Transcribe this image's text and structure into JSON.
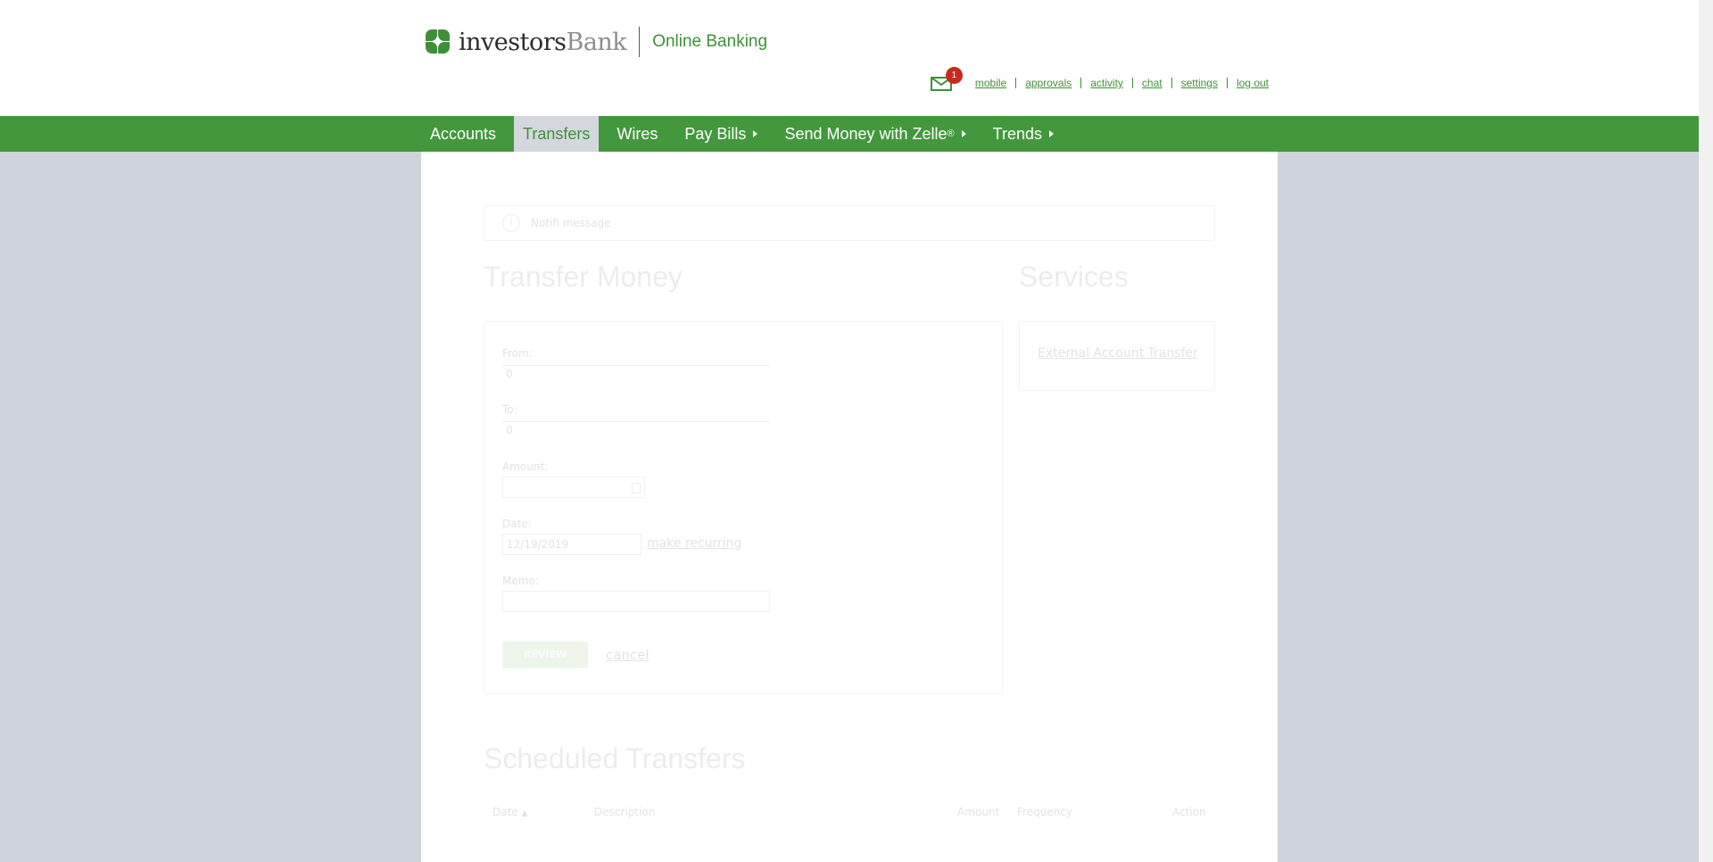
{
  "header": {
    "brand_part1": "investors",
    "brand_part2": "Bank",
    "product": "Online Banking",
    "message_count": "1",
    "utility_links": [
      "mobile",
      "approvals",
      "activity",
      "chat",
      "settings",
      "log out"
    ]
  },
  "nav": {
    "items": [
      {
        "label": "Accounts",
        "active": false,
        "has_caret": false
      },
      {
        "label": "Transfers",
        "active": true,
        "has_caret": false
      },
      {
        "label": "Wires",
        "active": false,
        "has_caret": false
      },
      {
        "label": "Pay Bills",
        "active": false,
        "has_caret": true
      },
      {
        "label": "Send Money with Zelle",
        "sup": "®",
        "active": false,
        "has_caret": true
      },
      {
        "label": "Trends",
        "active": false,
        "has_caret": true
      }
    ]
  },
  "notification": {
    "icon": "i",
    "text": "Notifi message"
  },
  "transfer": {
    "title": "Transfer Money",
    "from_label": "From:",
    "from_value": "0",
    "to_label": "To:",
    "to_value": "0",
    "amount_label": "Amount:",
    "amount_value": "",
    "date_label": "Date:",
    "date_value": "12/19/2019",
    "make_recurring": "make recurring",
    "memo_label": "Memo:",
    "memo_value": "",
    "review_button": "REVIEW",
    "cancel_link": "cancel"
  },
  "services": {
    "title": "Services",
    "links": [
      "External Account Transfer"
    ]
  },
  "scheduled": {
    "title": "Scheduled Transfers",
    "columns": [
      "Date",
      "Description",
      "Amount",
      "Frequency",
      "Action"
    ]
  },
  "colors": {
    "brand_green": "#43983d",
    "badge_red": "#c8291f",
    "page_bg": "#cfd3da"
  }
}
